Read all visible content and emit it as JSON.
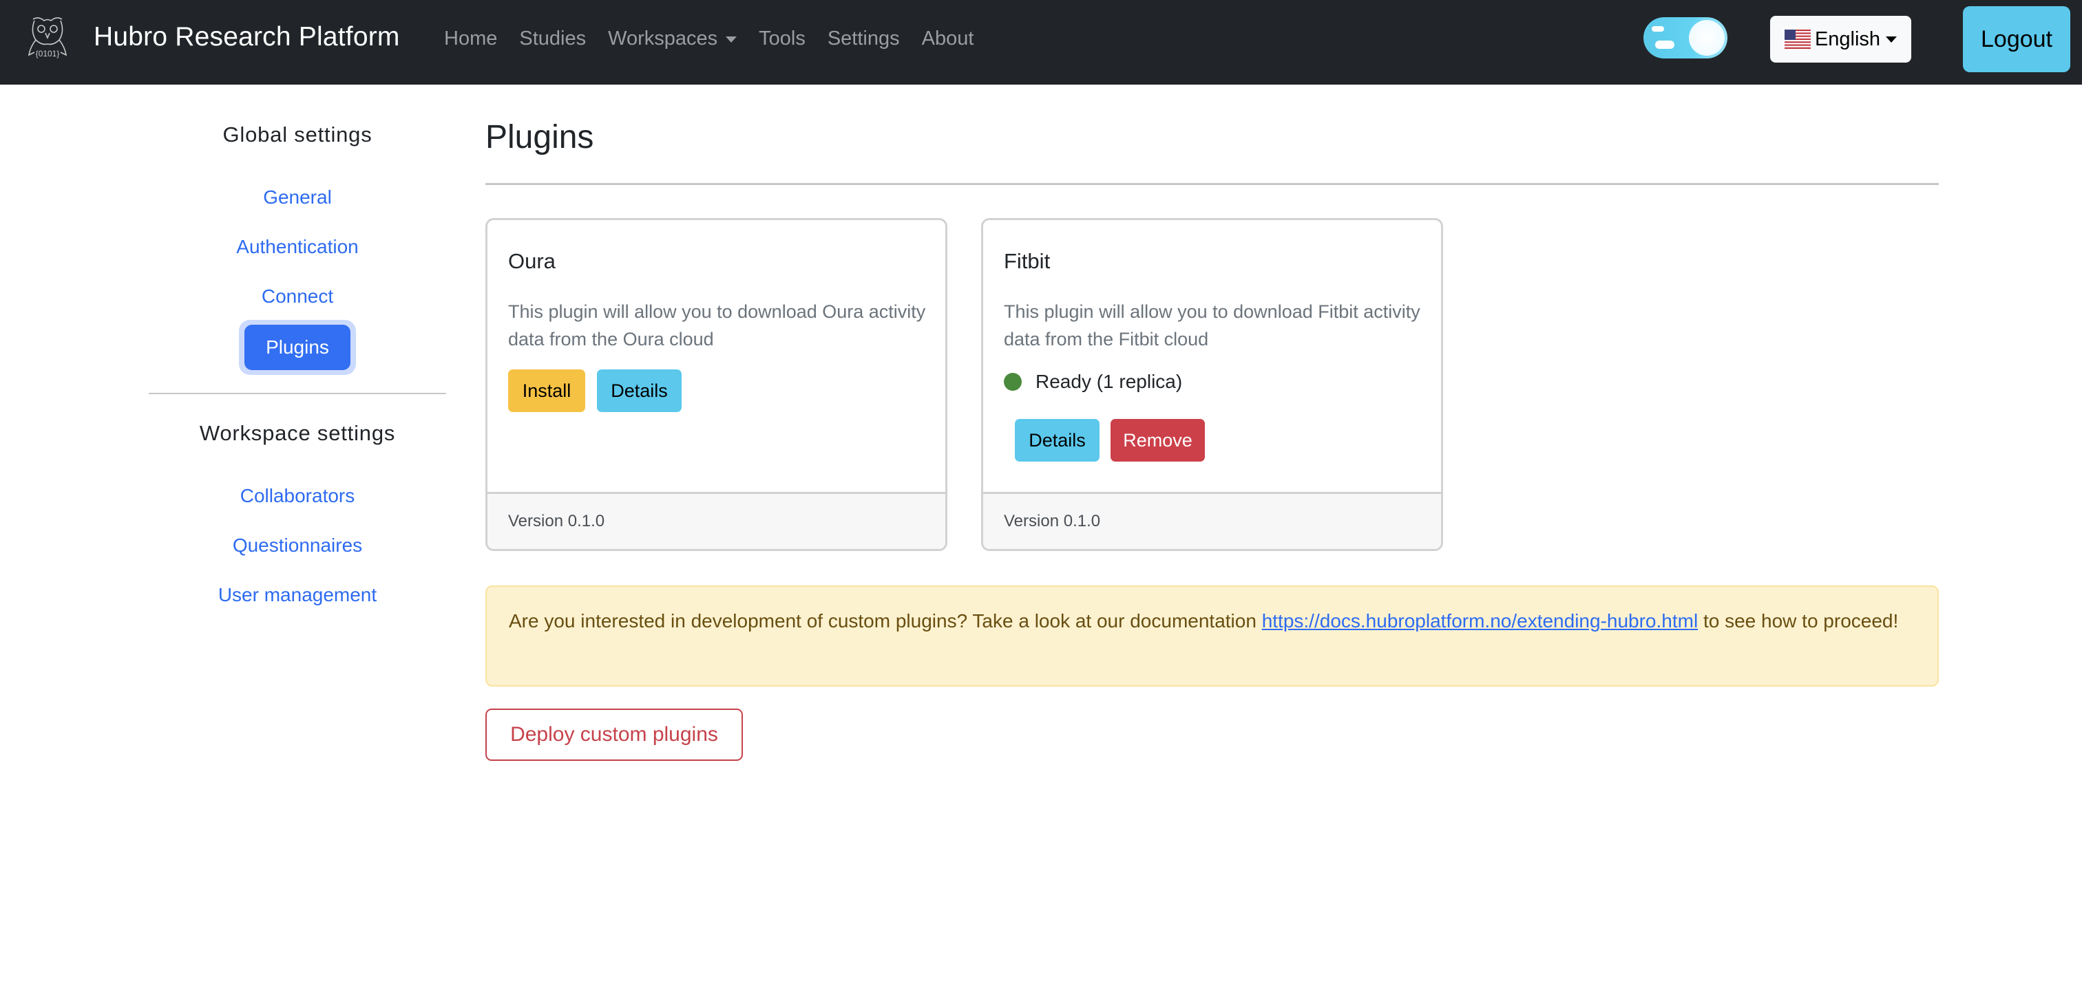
{
  "navbar": {
    "brand": "Hubro Research Platform",
    "logo_icon": "owl-logo-icon",
    "links": [
      {
        "label": "Home"
      },
      {
        "label": "Studies"
      },
      {
        "label": "Workspaces",
        "has_dropdown": true
      },
      {
        "label": "Tools"
      },
      {
        "label": "Settings"
      },
      {
        "label": "About"
      }
    ],
    "theme_toggle": {
      "state": "light",
      "icon": "cloud-toggle-icon"
    },
    "language": {
      "label": "English",
      "flag_icon": "us-flag-icon"
    },
    "logout_label": "Logout"
  },
  "sidebar": {
    "global_heading": "Global settings",
    "global_items": [
      {
        "label": "General",
        "active": false
      },
      {
        "label": "Authentication",
        "active": false
      },
      {
        "label": "Connect",
        "active": false
      },
      {
        "label": "Plugins",
        "active": true
      }
    ],
    "workspace_heading": "Workspace settings",
    "workspace_items": [
      {
        "label": "Collaborators"
      },
      {
        "label": "Questionnaires"
      },
      {
        "label": "User management"
      }
    ]
  },
  "main": {
    "title": "Plugins",
    "plugins": [
      {
        "name": "Oura",
        "description": "This plugin will allow you to download Oura activity data from the Oura cloud",
        "buttons": [
          {
            "label": "Install",
            "variant": "warning"
          },
          {
            "label": "Details",
            "variant": "info"
          }
        ],
        "version": "Version 0.1.0"
      },
      {
        "name": "Fitbit",
        "description": "This plugin will allow you to download Fitbit activity data from the Fitbit cloud",
        "status": {
          "text": "Ready (1 replica)",
          "color": "#4a8a3d"
        },
        "buttons": [
          {
            "label": "Details",
            "variant": "info"
          },
          {
            "label": "Remove",
            "variant": "danger"
          }
        ],
        "version": "Version 0.1.0"
      }
    ],
    "alert": {
      "text_before": "Are you interested in development of custom plugins? Take a look at our documentation ",
      "link": "https://docs.hubroplatform.no/extending-hubro.html",
      "text_after": " to see how to proceed!"
    },
    "deploy_label": "Deploy custom plugins"
  },
  "colors": {
    "navbar_bg": "#212529",
    "primary": "#326ff2",
    "link": "#2d6bf0",
    "warning": "#f6c244",
    "info": "#5bc8ec",
    "danger": "#cc4049",
    "status_ready": "#4a8a3d",
    "alert_bg": "#fdf2d0"
  }
}
